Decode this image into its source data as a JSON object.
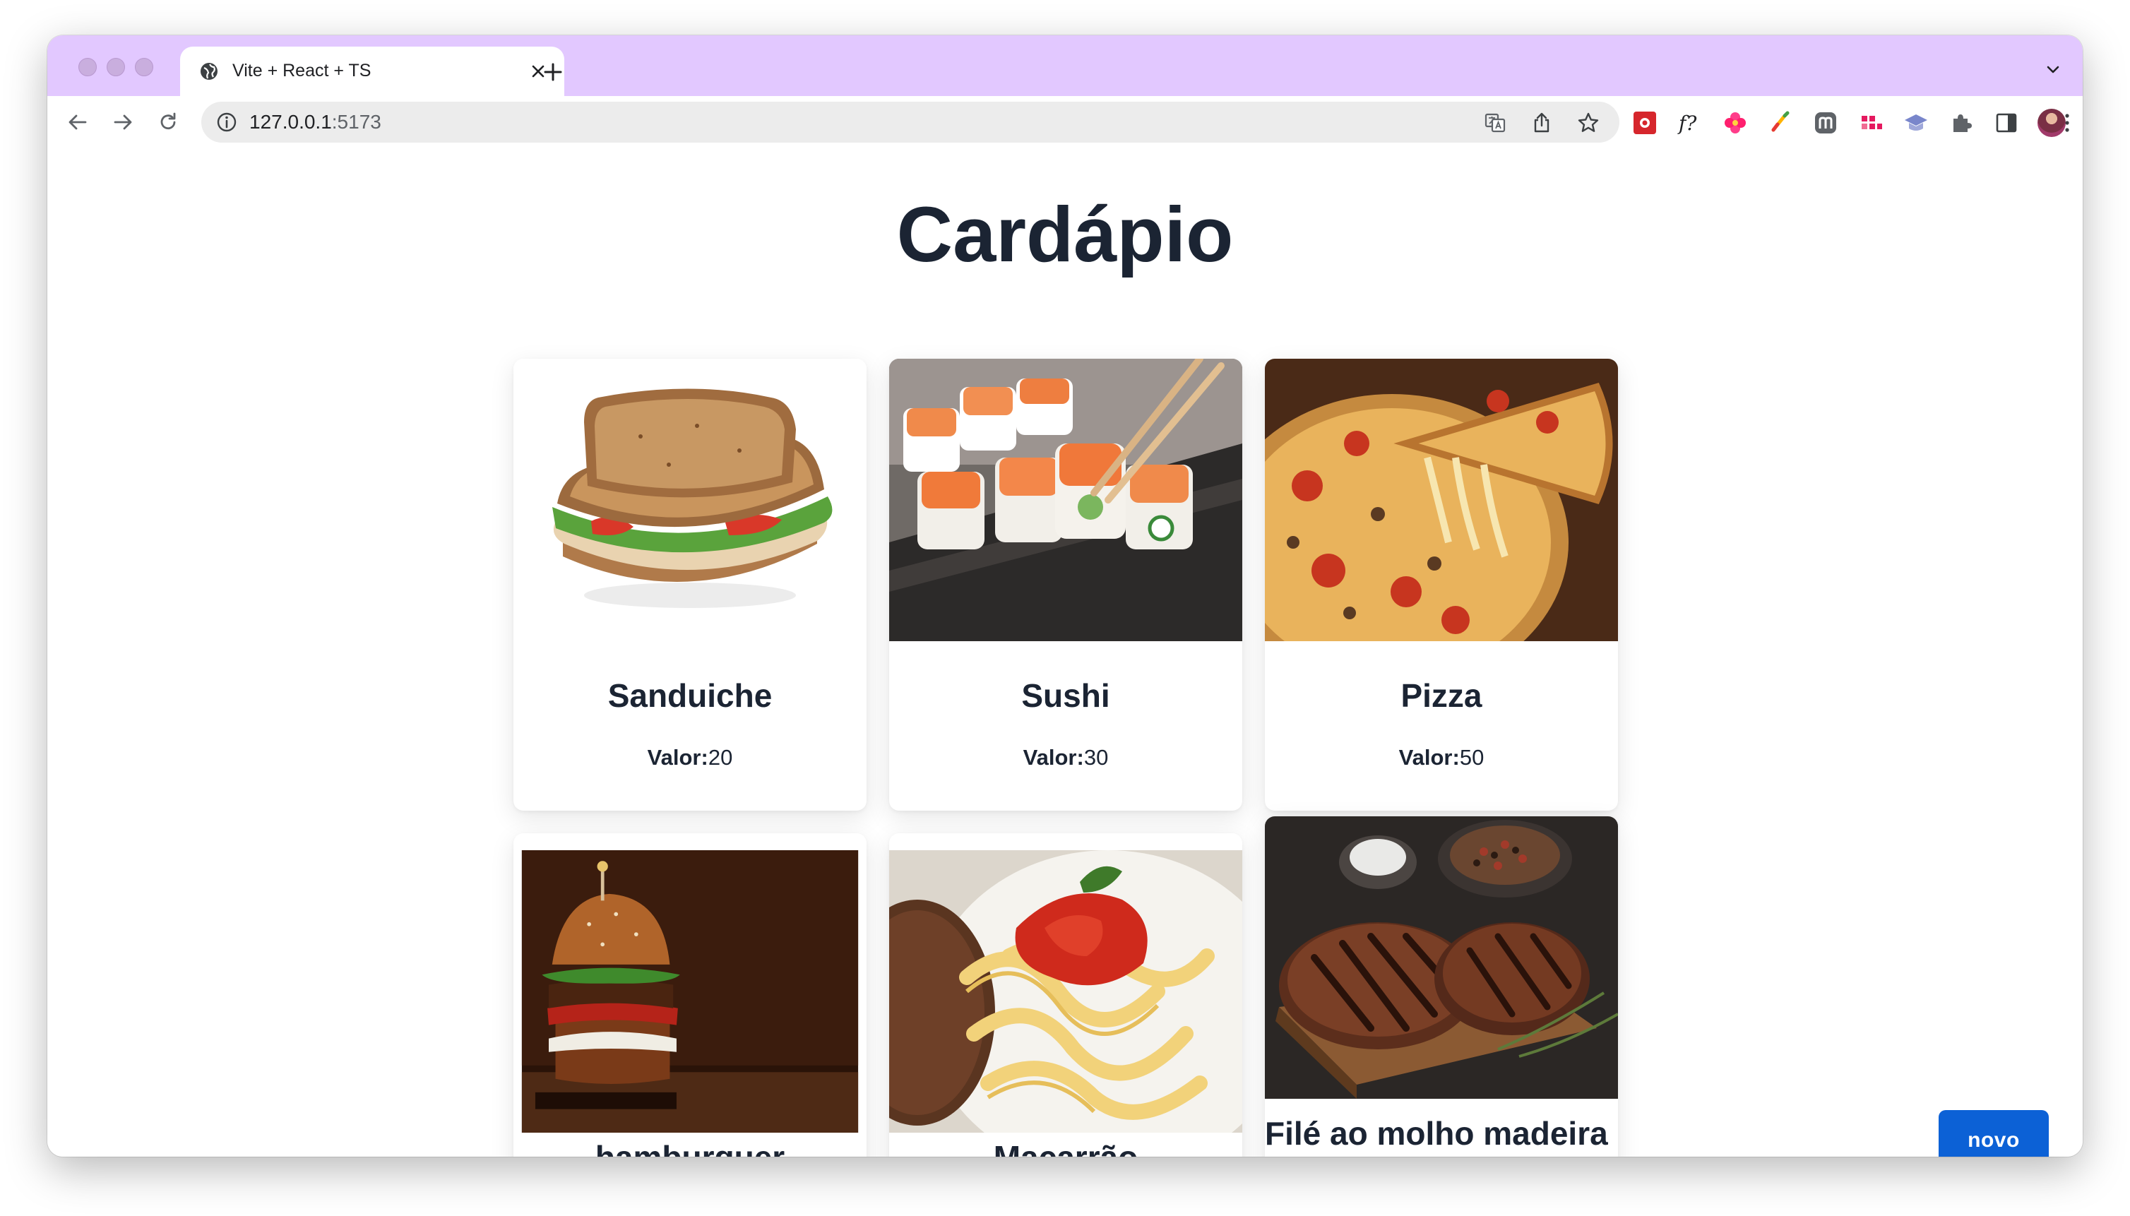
{
  "browser": {
    "tab": {
      "title": "Vite + React + TS"
    },
    "address_bar": {
      "host": "127.0.0.1",
      "port": ":5173"
    }
  },
  "page": {
    "title": "Cardápio",
    "price_label": "Valor:",
    "new_button_label": "novo",
    "items": [
      {
        "name": "Sanduiche",
        "price": "20",
        "image": "sandwich-photo"
      },
      {
        "name": "Sushi",
        "price": "30",
        "image": "sushi-photo"
      },
      {
        "name": "Pizza",
        "price": "50",
        "image": "pizza-photo"
      },
      {
        "name": "hamburguer",
        "image": "burger-photo"
      },
      {
        "name": "Macarrão",
        "image": "pasta-photo"
      },
      {
        "name": "Filé ao molho madeira",
        "image": "steak-photo"
      }
    ]
  },
  "colors": {
    "tabstrip": "#e2c8ff",
    "title_text": "#1b2433",
    "button": "#0c61d6"
  }
}
